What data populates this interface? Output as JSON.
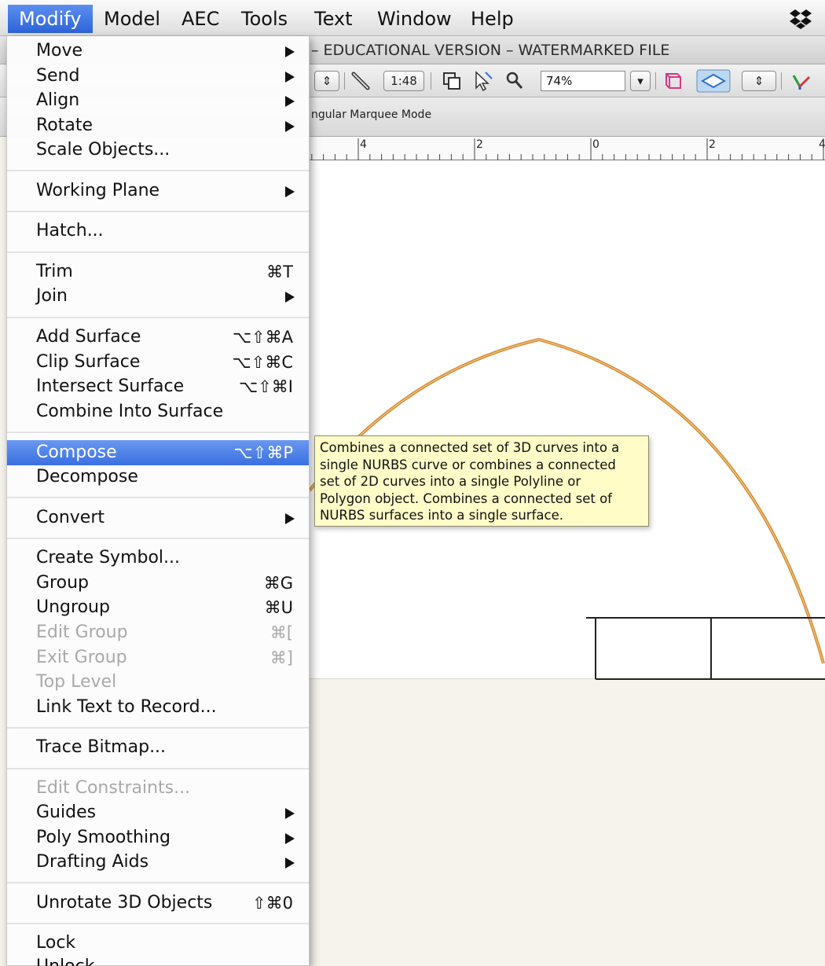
{
  "menubar": {
    "items": [
      {
        "label": "Modify",
        "active": true
      },
      {
        "label": "Model"
      },
      {
        "label": "AEC"
      },
      {
        "label": "Tools"
      },
      {
        "label": "Text"
      },
      {
        "label": "Window"
      },
      {
        "label": "Help"
      }
    ],
    "right_icon": "dropbox-icon"
  },
  "window": {
    "title": "– EDUCATIONAL VERSION – WATERMARKED FILE"
  },
  "toolbar": {
    "scale": "1:48",
    "zoom": "74%",
    "icons": [
      "pencil-icon",
      "layer-icon",
      "cursor-icon",
      "magnifier-icon",
      "view-cube-icon",
      "plane-icon",
      "axis-icon"
    ]
  },
  "modebar": {
    "text": "ngular Marquee Mode"
  },
  "ruler": {
    "labels": [
      "4",
      "2",
      "0",
      "2",
      "4"
    ]
  },
  "menu": {
    "items": [
      {
        "label": "Move",
        "submenu": true
      },
      {
        "label": "Send",
        "submenu": true
      },
      {
        "label": "Align",
        "submenu": true
      },
      {
        "label": "Rotate",
        "submenu": true
      },
      {
        "label": "Scale Objects..."
      },
      {
        "label": "Working Plane",
        "submenu": true
      },
      {
        "label": "Hatch..."
      },
      {
        "label": "Trim",
        "shortcut": "⌘T"
      },
      {
        "label": "Join",
        "submenu": true
      },
      {
        "label": "Add Surface",
        "shortcut": "⌥⇧⌘A"
      },
      {
        "label": "Clip Surface",
        "shortcut": "⌥⇧⌘C"
      },
      {
        "label": "Intersect Surface",
        "shortcut": "⌥⇧⌘I"
      },
      {
        "label": "Combine Into Surface"
      },
      {
        "label": "Compose",
        "shortcut": "⌥⇧⌘P",
        "highlighted": true
      },
      {
        "label": "Decompose"
      },
      {
        "label": "Convert",
        "submenu": true
      },
      {
        "label": "Create Symbol..."
      },
      {
        "label": "Group",
        "shortcut": "⌘G"
      },
      {
        "label": "Ungroup",
        "shortcut": "⌘U"
      },
      {
        "label": "Edit Group",
        "shortcut": "⌘[",
        "disabled": true
      },
      {
        "label": "Exit Group",
        "shortcut": "⌘]",
        "disabled": true
      },
      {
        "label": "Top Level",
        "disabled": true
      },
      {
        "label": "Link Text to Record..."
      },
      {
        "label": "Trace Bitmap..."
      },
      {
        "label": "Edit Constraints...",
        "disabled": true
      },
      {
        "label": "Guides",
        "submenu": true
      },
      {
        "label": "Poly Smoothing",
        "submenu": true
      },
      {
        "label": "Drafting Aids",
        "submenu": true
      },
      {
        "label": "Unrotate 3D Objects",
        "shortcut": "⇧⌘0"
      },
      {
        "label": "Lock"
      },
      {
        "label": "Unlock"
      }
    ]
  },
  "tooltip": {
    "lines": [
      "Combines a connected set of 3D curves into a",
      "single NURBS curve or combines a connected",
      "set of 2D curves into a single Polyline or",
      "Polygon object. Combines a connected set of",
      "NURBS surfaces into a single surface."
    ]
  },
  "colors": {
    "menu_highlight": "#3a6fe0",
    "arc_stroke": "#d2892e",
    "tooltip_bg": "#fffcc8"
  }
}
